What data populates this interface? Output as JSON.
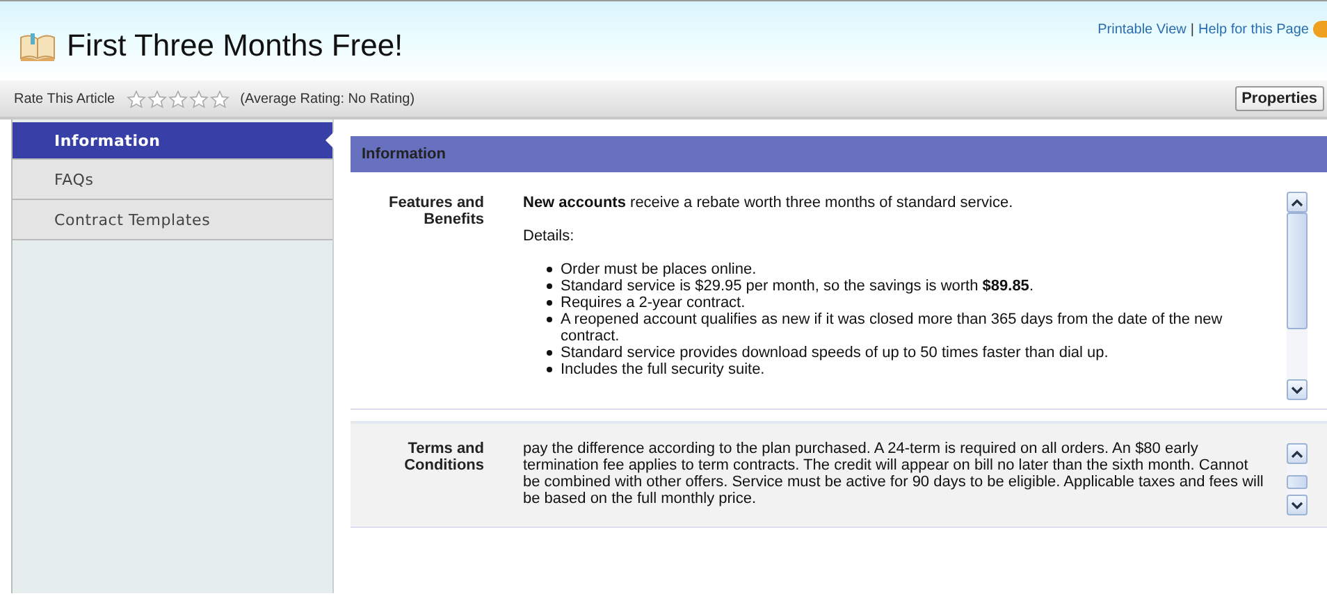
{
  "header": {
    "title": "First Three Months Free!",
    "links": [
      "Printable View",
      "Help for this Page"
    ],
    "separator": "|"
  },
  "rating_bar": {
    "label": "Rate This Article",
    "stars": 0,
    "average": "(Average Rating: No Rating)",
    "button": "Properties"
  },
  "sidebar": {
    "items": [
      {
        "label": "Information",
        "selected": true
      },
      {
        "label": "FAQs",
        "selected": false
      },
      {
        "label": "Contract Templates",
        "selected": false
      }
    ]
  },
  "panel": {
    "title": "Information",
    "sections": [
      {
        "label": "Features and Benefits",
        "intro": "**New accounts** receive a rebate worth three months of standard service.",
        "subheading": "Details:",
        "bullets": [
          "Order must be places online.",
          "Standard service is $29.95 per month, so the savings is worth **$89.85**.",
          "Requires a 2-year contract.",
          "A reopened account qualifies as new if it was closed more than 365 days from the date of the new contract.",
          "Standard service provides download speeds of up to 50 times faster than dial up.",
          "Includes the full security suite."
        ]
      },
      {
        "label": "Terms and Conditions",
        "text": "pay the difference according to the plan purchased. A 24-term is required on all orders. An $80 early termination fee applies to term contracts. The credit will appear on bill no later than the sixth month. Cannot be combined with other offers. Service must be active for 90 days to be eligible. Applicable taxes and fees will be based on the full monthly price."
      }
    ]
  }
}
